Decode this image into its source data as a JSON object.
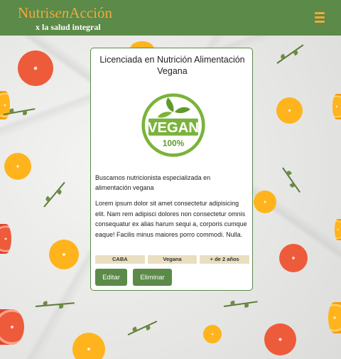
{
  "header": {
    "brand_prefix": "Nutris",
    "brand_middle": "en",
    "brand_suffix": "Acción",
    "tagline": "x la salud integral",
    "menu_icon": "hamburger-icon",
    "brand_color": "#f2a93b",
    "bar_color": "#5b8a49"
  },
  "card": {
    "title": "Licenciada en Nutrición Alimentación Vegana",
    "logo_text": "VEGAN",
    "logo_sub": "100%",
    "lead": "Buscamos nutricionista especializada en alimentación vegana",
    "body": "Lorem ipsum dolor sit amet consectetur adipisicing elit. Nam rem adipisci dolores non consectetur omnis consequatur ex alias harum sequi a, corporis cumque eaque! Facilis minus maiores porro commodi. Nulla.",
    "tags": [
      "CABA",
      "Vegana",
      "+ de 2 años"
    ],
    "edit_label": "Editar",
    "delete_label": "Eliminar"
  }
}
